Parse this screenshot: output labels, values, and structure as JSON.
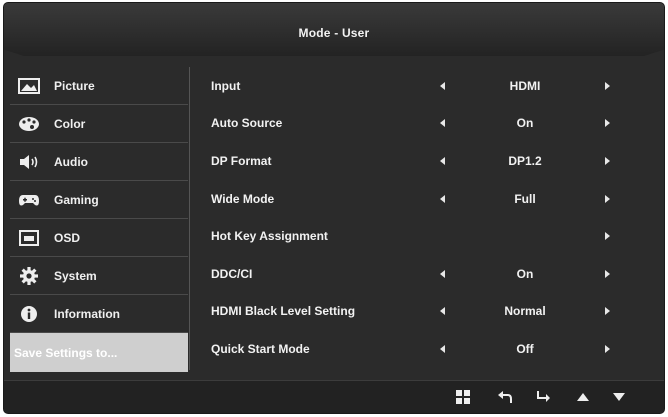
{
  "window": {
    "title": "Mode - User"
  },
  "sidebar": {
    "items": [
      {
        "label": "Picture",
        "icon": "picture-icon"
      },
      {
        "label": "Color",
        "icon": "palette-icon"
      },
      {
        "label": "Audio",
        "icon": "speaker-icon"
      },
      {
        "label": "Gaming",
        "icon": "gamepad-icon"
      },
      {
        "label": "OSD",
        "icon": "osd-icon"
      },
      {
        "label": "System",
        "icon": "gear-icon"
      },
      {
        "label": "Information",
        "icon": "info-icon"
      },
      {
        "label": "Save Settings to..."
      }
    ],
    "active_index": 7
  },
  "settings": [
    {
      "name": "Input",
      "value": "HDMI"
    },
    {
      "name": "Auto Source",
      "value": "On"
    },
    {
      "name": "DP Format",
      "value": "DP1.2"
    },
    {
      "name": "Wide Mode",
      "value": "Full"
    },
    {
      "name": "Hot Key Assignment",
      "value": ""
    },
    {
      "name": "DDC/CI",
      "value": "On"
    },
    {
      "name": "HDMI Black Level Setting",
      "value": "Normal"
    },
    {
      "name": "Quick Start Mode",
      "value": "Off"
    }
  ],
  "footer": {
    "buttons": [
      "menu-grid-icon",
      "back-icon",
      "enter-icon",
      "up-arrow-icon",
      "down-arrow-icon"
    ]
  },
  "colors": {
    "panel": "#2b2b2b",
    "active_sidebar": "#cfcfcf",
    "text": "#f2f2f2"
  }
}
